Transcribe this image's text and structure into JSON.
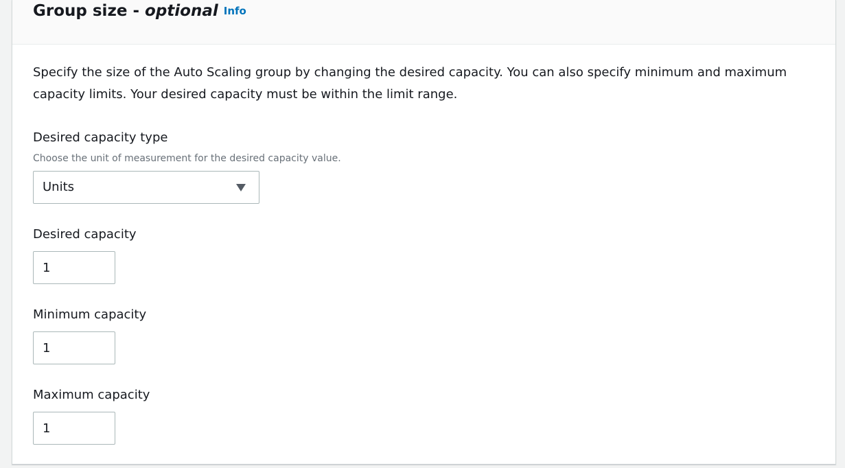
{
  "section": {
    "title": "Group size",
    "title_dash": "-",
    "title_optional": "optional",
    "info_link": "Info",
    "description": "Specify the size of the Auto Scaling group by changing the desired capacity. You can also specify minimum and maximum capacity limits. Your desired capacity must be within the limit range."
  },
  "desired_capacity_type": {
    "label": "Desired capacity type",
    "hint": "Choose the unit of measurement for the desired capacity value.",
    "selected": "Units",
    "icon": "caret-down-icon"
  },
  "desired_capacity": {
    "label": "Desired capacity",
    "value": "1"
  },
  "minimum_capacity": {
    "label": "Minimum capacity",
    "value": "1"
  },
  "maximum_capacity": {
    "label": "Maximum capacity",
    "value": "1"
  },
  "colors": {
    "info_link": "#0073bb",
    "header_bg": "#fafafa",
    "page_bg": "#f2f3f3",
    "input_border": "#aab7b8"
  }
}
